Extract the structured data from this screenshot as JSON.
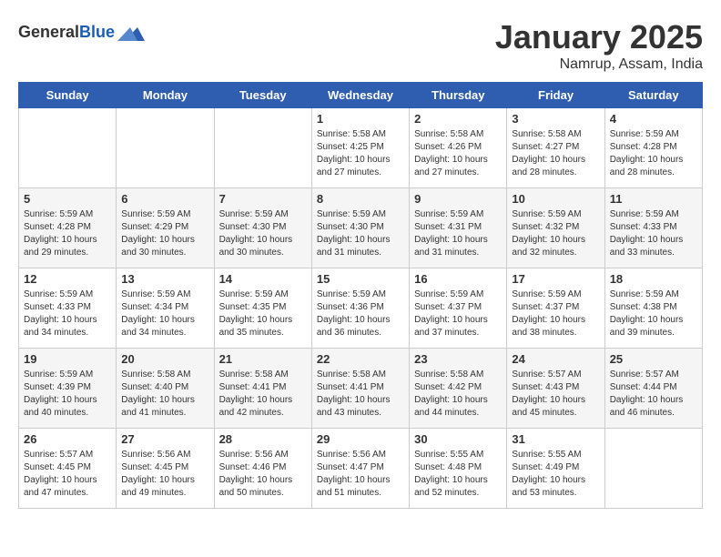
{
  "header": {
    "logo_general": "General",
    "logo_blue": "Blue",
    "title": "January 2025",
    "subtitle": "Namrup, Assam, India"
  },
  "days_of_week": [
    "Sunday",
    "Monday",
    "Tuesday",
    "Wednesday",
    "Thursday",
    "Friday",
    "Saturday"
  ],
  "weeks": [
    [
      {
        "day": "",
        "sunrise": "",
        "sunset": "",
        "daylight": ""
      },
      {
        "day": "",
        "sunrise": "",
        "sunset": "",
        "daylight": ""
      },
      {
        "day": "",
        "sunrise": "",
        "sunset": "",
        "daylight": ""
      },
      {
        "day": "1",
        "sunrise": "Sunrise: 5:58 AM",
        "sunset": "Sunset: 4:25 PM",
        "daylight": "Daylight: 10 hours and 27 minutes."
      },
      {
        "day": "2",
        "sunrise": "Sunrise: 5:58 AM",
        "sunset": "Sunset: 4:26 PM",
        "daylight": "Daylight: 10 hours and 27 minutes."
      },
      {
        "day": "3",
        "sunrise": "Sunrise: 5:58 AM",
        "sunset": "Sunset: 4:27 PM",
        "daylight": "Daylight: 10 hours and 28 minutes."
      },
      {
        "day": "4",
        "sunrise": "Sunrise: 5:59 AM",
        "sunset": "Sunset: 4:28 PM",
        "daylight": "Daylight: 10 hours and 28 minutes."
      }
    ],
    [
      {
        "day": "5",
        "sunrise": "Sunrise: 5:59 AM",
        "sunset": "Sunset: 4:28 PM",
        "daylight": "Daylight: 10 hours and 29 minutes."
      },
      {
        "day": "6",
        "sunrise": "Sunrise: 5:59 AM",
        "sunset": "Sunset: 4:29 PM",
        "daylight": "Daylight: 10 hours and 30 minutes."
      },
      {
        "day": "7",
        "sunrise": "Sunrise: 5:59 AM",
        "sunset": "Sunset: 4:30 PM",
        "daylight": "Daylight: 10 hours and 30 minutes."
      },
      {
        "day": "8",
        "sunrise": "Sunrise: 5:59 AM",
        "sunset": "Sunset: 4:30 PM",
        "daylight": "Daylight: 10 hours and 31 minutes."
      },
      {
        "day": "9",
        "sunrise": "Sunrise: 5:59 AM",
        "sunset": "Sunset: 4:31 PM",
        "daylight": "Daylight: 10 hours and 31 minutes."
      },
      {
        "day": "10",
        "sunrise": "Sunrise: 5:59 AM",
        "sunset": "Sunset: 4:32 PM",
        "daylight": "Daylight: 10 hours and 32 minutes."
      },
      {
        "day": "11",
        "sunrise": "Sunrise: 5:59 AM",
        "sunset": "Sunset: 4:33 PM",
        "daylight": "Daylight: 10 hours and 33 minutes."
      }
    ],
    [
      {
        "day": "12",
        "sunrise": "Sunrise: 5:59 AM",
        "sunset": "Sunset: 4:33 PM",
        "daylight": "Daylight: 10 hours and 34 minutes."
      },
      {
        "day": "13",
        "sunrise": "Sunrise: 5:59 AM",
        "sunset": "Sunset: 4:34 PM",
        "daylight": "Daylight: 10 hours and 34 minutes."
      },
      {
        "day": "14",
        "sunrise": "Sunrise: 5:59 AM",
        "sunset": "Sunset: 4:35 PM",
        "daylight": "Daylight: 10 hours and 35 minutes."
      },
      {
        "day": "15",
        "sunrise": "Sunrise: 5:59 AM",
        "sunset": "Sunset: 4:36 PM",
        "daylight": "Daylight: 10 hours and 36 minutes."
      },
      {
        "day": "16",
        "sunrise": "Sunrise: 5:59 AM",
        "sunset": "Sunset: 4:37 PM",
        "daylight": "Daylight: 10 hours and 37 minutes."
      },
      {
        "day": "17",
        "sunrise": "Sunrise: 5:59 AM",
        "sunset": "Sunset: 4:37 PM",
        "daylight": "Daylight: 10 hours and 38 minutes."
      },
      {
        "day": "18",
        "sunrise": "Sunrise: 5:59 AM",
        "sunset": "Sunset: 4:38 PM",
        "daylight": "Daylight: 10 hours and 39 minutes."
      }
    ],
    [
      {
        "day": "19",
        "sunrise": "Sunrise: 5:59 AM",
        "sunset": "Sunset: 4:39 PM",
        "daylight": "Daylight: 10 hours and 40 minutes."
      },
      {
        "day": "20",
        "sunrise": "Sunrise: 5:58 AM",
        "sunset": "Sunset: 4:40 PM",
        "daylight": "Daylight: 10 hours and 41 minutes."
      },
      {
        "day": "21",
        "sunrise": "Sunrise: 5:58 AM",
        "sunset": "Sunset: 4:41 PM",
        "daylight": "Daylight: 10 hours and 42 minutes."
      },
      {
        "day": "22",
        "sunrise": "Sunrise: 5:58 AM",
        "sunset": "Sunset: 4:41 PM",
        "daylight": "Daylight: 10 hours and 43 minutes."
      },
      {
        "day": "23",
        "sunrise": "Sunrise: 5:58 AM",
        "sunset": "Sunset: 4:42 PM",
        "daylight": "Daylight: 10 hours and 44 minutes."
      },
      {
        "day": "24",
        "sunrise": "Sunrise: 5:57 AM",
        "sunset": "Sunset: 4:43 PM",
        "daylight": "Daylight: 10 hours and 45 minutes."
      },
      {
        "day": "25",
        "sunrise": "Sunrise: 5:57 AM",
        "sunset": "Sunset: 4:44 PM",
        "daylight": "Daylight: 10 hours and 46 minutes."
      }
    ],
    [
      {
        "day": "26",
        "sunrise": "Sunrise: 5:57 AM",
        "sunset": "Sunset: 4:45 PM",
        "daylight": "Daylight: 10 hours and 47 minutes."
      },
      {
        "day": "27",
        "sunrise": "Sunrise: 5:56 AM",
        "sunset": "Sunset: 4:45 PM",
        "daylight": "Daylight: 10 hours and 49 minutes."
      },
      {
        "day": "28",
        "sunrise": "Sunrise: 5:56 AM",
        "sunset": "Sunset: 4:46 PM",
        "daylight": "Daylight: 10 hours and 50 minutes."
      },
      {
        "day": "29",
        "sunrise": "Sunrise: 5:56 AM",
        "sunset": "Sunset: 4:47 PM",
        "daylight": "Daylight: 10 hours and 51 minutes."
      },
      {
        "day": "30",
        "sunrise": "Sunrise: 5:55 AM",
        "sunset": "Sunset: 4:48 PM",
        "daylight": "Daylight: 10 hours and 52 minutes."
      },
      {
        "day": "31",
        "sunrise": "Sunrise: 5:55 AM",
        "sunset": "Sunset: 4:49 PM",
        "daylight": "Daylight: 10 hours and 53 minutes."
      },
      {
        "day": "",
        "sunrise": "",
        "sunset": "",
        "daylight": ""
      }
    ]
  ]
}
